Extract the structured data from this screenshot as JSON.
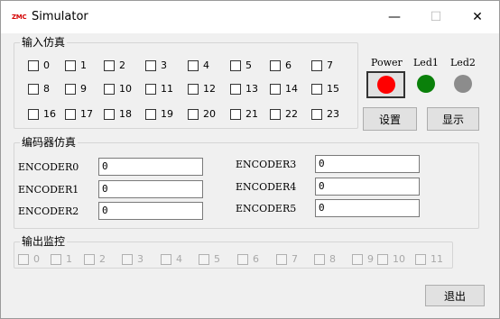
{
  "window": {
    "logo": "ZMC",
    "title": "Simulator",
    "controls": {
      "minimize": "—",
      "maximize": "☐",
      "close": "✕"
    }
  },
  "input_sim": {
    "title": "输入仿真",
    "items": [
      "0",
      "1",
      "2",
      "3",
      "4",
      "5",
      "6",
      "7",
      "8",
      "9",
      "10",
      "11",
      "12",
      "13",
      "14",
      "15",
      "16",
      "17",
      "18",
      "19",
      "20",
      "21",
      "22",
      "23"
    ]
  },
  "leds": {
    "power": {
      "label": "Power",
      "color": "#ff0000"
    },
    "led1": {
      "label": "Led1",
      "color": "#0a800a"
    },
    "led2": {
      "label": "Led2",
      "color": "#8c8c8c"
    }
  },
  "buttons": {
    "settings": "设置",
    "display": "显示",
    "exit": "退出"
  },
  "encoder_sim": {
    "title": "编码器仿真",
    "encoders": [
      {
        "label": "ENCODER0",
        "value": "0"
      },
      {
        "label": "ENCODER1",
        "value": "0"
      },
      {
        "label": "ENCODER2",
        "value": "0"
      },
      {
        "label": "ENCODER3",
        "value": "0"
      },
      {
        "label": "ENCODER4",
        "value": "0"
      },
      {
        "label": "ENCODER5",
        "value": "0"
      }
    ]
  },
  "output_monitor": {
    "title": "输出监控",
    "items": [
      "0",
      "1",
      "2",
      "3",
      "4",
      "5",
      "6",
      "7",
      "8",
      "9",
      "10",
      "11"
    ]
  }
}
